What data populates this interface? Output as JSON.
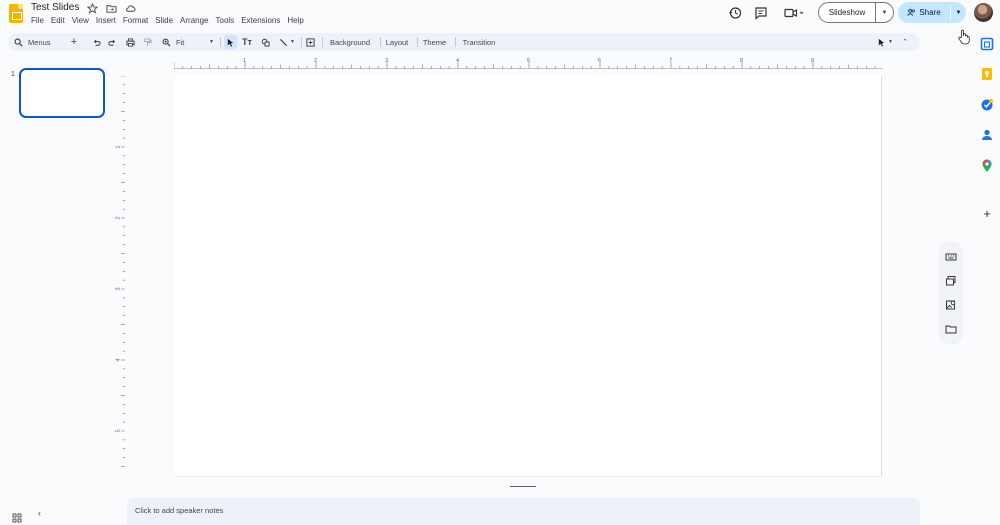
{
  "document": {
    "title": "Test Slides"
  },
  "menubar": {
    "items": [
      "File",
      "Edit",
      "View",
      "Insert",
      "Format",
      "Slide",
      "Arrange",
      "Tools",
      "Extensions",
      "Help"
    ]
  },
  "header": {
    "slideshow_label": "Slideshow",
    "share_label": "Share"
  },
  "toolbar": {
    "menus_label": "Menus",
    "zoom_label": "Fit",
    "background_label": "Background",
    "layout_label": "Layout",
    "theme_label": "Theme",
    "transition_label": "Transition"
  },
  "filmstrip": {
    "slides": [
      {
        "number": "1"
      }
    ]
  },
  "rulers": {
    "horizontal_numbers": [
      "1",
      "2",
      "3",
      "4",
      "5",
      "6",
      "7",
      "8",
      "9"
    ],
    "vertical_numbers": [
      "1",
      "2",
      "3",
      "4",
      "5"
    ]
  },
  "notes": {
    "placeholder": "Click to add speaker notes"
  },
  "colors": {
    "accent": "#0b57d0",
    "share_bg": "#c2e7ff",
    "toolbar_bg": "#edf2fa",
    "page_bg": "#f9fbfd"
  }
}
